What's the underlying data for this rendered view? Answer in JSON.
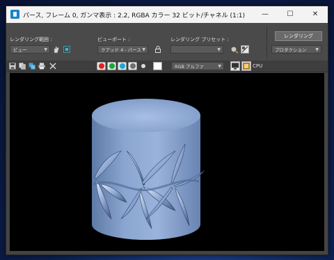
{
  "window": {
    "title": "パース, フレーム 0, ガンマ表示 : 2.2, RGBA カラー 32 ビット/チャネル (1:1)",
    "controls": {
      "minimize": "—",
      "maximize": "☐",
      "close": "✕"
    }
  },
  "toolbar": {
    "render_area_label": "レンダリング範囲 :",
    "render_area_value": "ビュー",
    "viewport_label": "ビューポート :",
    "viewport_value": "クアッド 4 - パース",
    "preset_label": "レンダリング プリセット :",
    "preset_value": "",
    "render_button": "レンダリング",
    "production_value": "プロダクション"
  },
  "toolbar2": {
    "channels": [
      {
        "name": "red",
        "color": "#e02020"
      },
      {
        "name": "green",
        "color": "#18a83a"
      },
      {
        "name": "blue",
        "color": "#1aa6d8"
      },
      {
        "name": "alpha",
        "color": "#707070"
      }
    ],
    "channel_display_value": "RGB アルファ",
    "cpu_label": "CPU"
  },
  "render_output": {
    "background_color": "#000000",
    "object_color": "#8fa8d0"
  }
}
